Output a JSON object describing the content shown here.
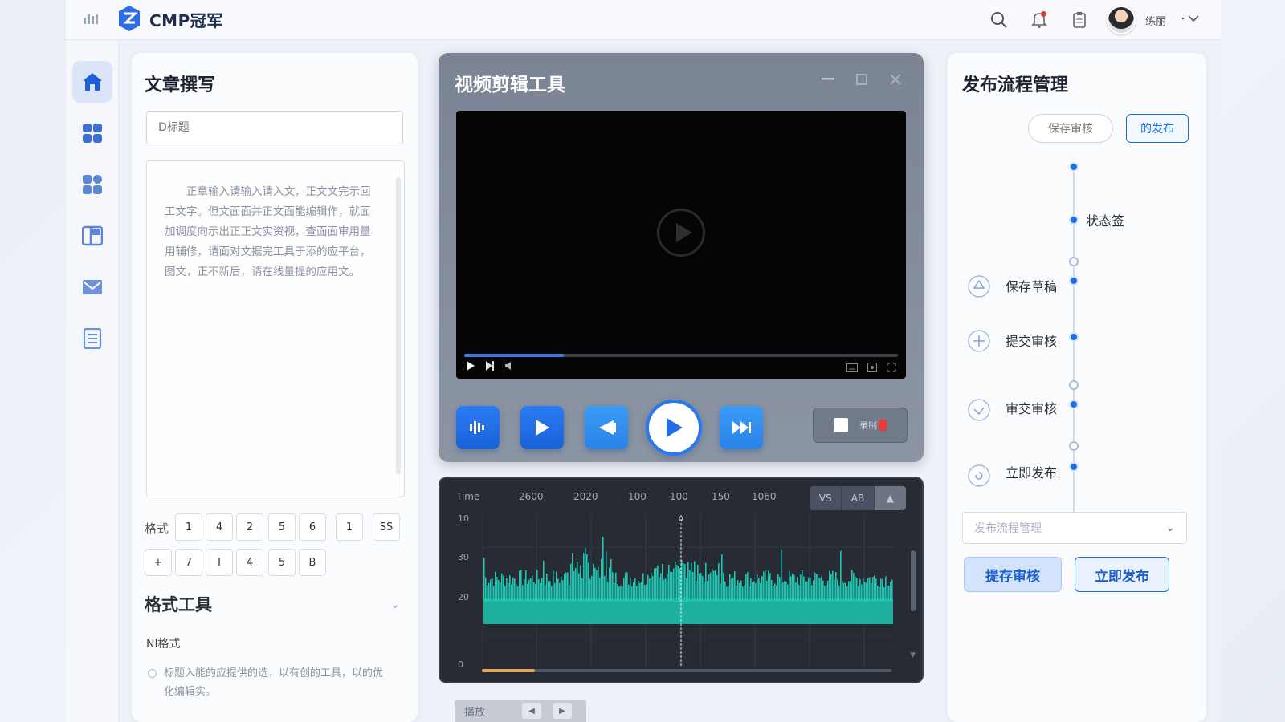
{
  "header": {
    "brand": "CMP冠军",
    "username": "练丽",
    "icons": [
      "menu-icon",
      "search-icon",
      "bell-icon",
      "clipboard-icon",
      "avatar",
      "chevron-down-icon"
    ]
  },
  "sidebar": {
    "items": [
      {
        "icon": "home-icon",
        "active": true
      },
      {
        "icon": "grid-icon"
      },
      {
        "icon": "apps-icon"
      },
      {
        "icon": "layout-icon"
      },
      {
        "icon": "mail-icon"
      },
      {
        "icon": "document-icon"
      }
    ]
  },
  "article": {
    "title": "文章撰写",
    "title_placeholder": "D标题",
    "body": "正章输入请输入请入文，正文文完示回工文字。但文面面并正文面能编辑作，就面加调度向示出正正文实资视，查面面审用量用辅修，请面对文据完工具于添的应平台，图文，正不新后，请在线量提的应用文。",
    "format_label": "格式",
    "format_row1": [
      "1",
      "4",
      "2",
      "5",
      "6",
      "1",
      "SS"
    ],
    "format_row2": [
      "+",
      "7",
      "I",
      "4",
      "5",
      "B"
    ],
    "format_tools_title": "格式工具",
    "format_sub": "Nl格式",
    "format_hint": "标题入能的应提供的选，以有创的工具，以的优化编辑实。"
  },
  "video": {
    "title": "视频剪辑工具",
    "progress": 0.23,
    "rec_label": "录制"
  },
  "timeline": {
    "labels": [
      "Time",
      "2600",
      "2020",
      "100",
      "100",
      "150",
      "1060"
    ],
    "y_labels": [
      "10",
      "30",
      "20",
      "0"
    ],
    "tools": [
      "VS",
      "AB",
      "▲"
    ],
    "scrub_progress": 0.13,
    "playhead_label": "0",
    "wave_color": "#1fc7b3"
  },
  "bottom_tab": {
    "label": "播放"
  },
  "publish": {
    "title": "发布流程管理",
    "btn_save_review": "保存审核",
    "btn_publish": "的发布",
    "status_label": "状态签",
    "steps": [
      {
        "label": "保存草稿",
        "icon": "upload-icon"
      },
      {
        "label": "提交审核",
        "icon": "plus-circle-icon"
      },
      {
        "label": "审交审核",
        "icon": "check-circle-icon"
      },
      {
        "label": "立即发布",
        "icon": "refresh-circle-icon"
      }
    ],
    "select_placeholder": "发布流程管理",
    "action_save": "提存审核",
    "action_publish": "立即发布",
    "accent": "#1d6fe6"
  }
}
